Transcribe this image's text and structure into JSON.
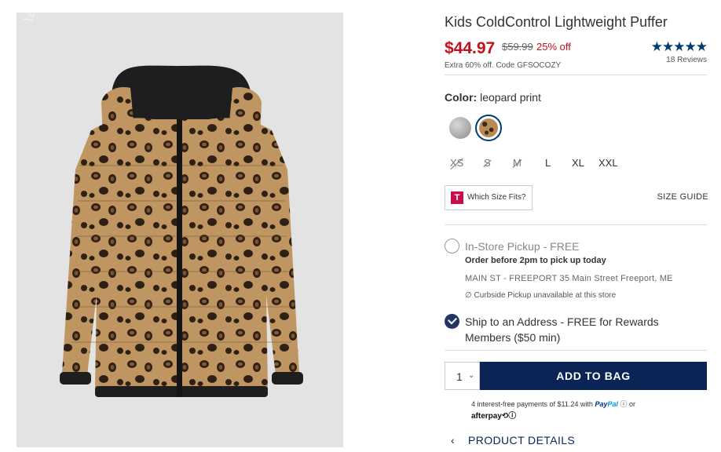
{
  "watermark": "ladies.ng.ua",
  "product": {
    "title": "Kids ColdControl Lightweight Puffer",
    "price": "$44.97",
    "old_price": "$59.99",
    "discount": "25% off",
    "promo": "Extra 60% off. Code GFSOCOZY",
    "rating_stars": "★★★★★",
    "rating_value": 4.5,
    "reviews": "18 Reviews"
  },
  "color": {
    "label": "Color:",
    "value": "leopard print",
    "swatches": [
      {
        "name": "grey",
        "color": "#a8a8a8",
        "selected": false
      },
      {
        "name": "leopard print",
        "color": "#b78b56",
        "selected": true
      }
    ]
  },
  "sizes": [
    {
      "label": "XS",
      "available": false
    },
    {
      "label": "S",
      "available": false
    },
    {
      "label": "M",
      "available": false
    },
    {
      "label": "L",
      "available": true
    },
    {
      "label": "XL",
      "available": true
    },
    {
      "label": "XXL",
      "available": true
    }
  ],
  "fit": {
    "logo": "T",
    "label": "Which Size Fits?"
  },
  "size_guide": "SIZE GUIDE",
  "pickup": {
    "title": "In-Store Pickup - FREE",
    "note": "Order before 2pm to pick up today",
    "store": "MAIN ST - FREEPORT 35 Main Street  Freeport, ME",
    "curbside": "∅ Curbside Pickup unavailable at this store",
    "selected": false
  },
  "ship": {
    "line1": "Ship to an Address - FREE for Rewards",
    "line2": "Members ($50 min)",
    "selected": true
  },
  "cart": {
    "quantity": "1",
    "caret": "⌄",
    "add_label": "ADD TO BAG"
  },
  "payments": {
    "text": "4 interest-free payments of $11.24 with",
    "paypal_a": "Pay",
    "paypal_b": "Pal",
    "info": "ⓘ or",
    "afterpay": "afterpay⟲ⓘ"
  },
  "details": {
    "chevron": "‹",
    "label": "PRODUCT DETAILS"
  },
  "colors": {
    "price_red": "#c50f1a",
    "navy": "#0a2456",
    "star_blue": "#003c71"
  }
}
